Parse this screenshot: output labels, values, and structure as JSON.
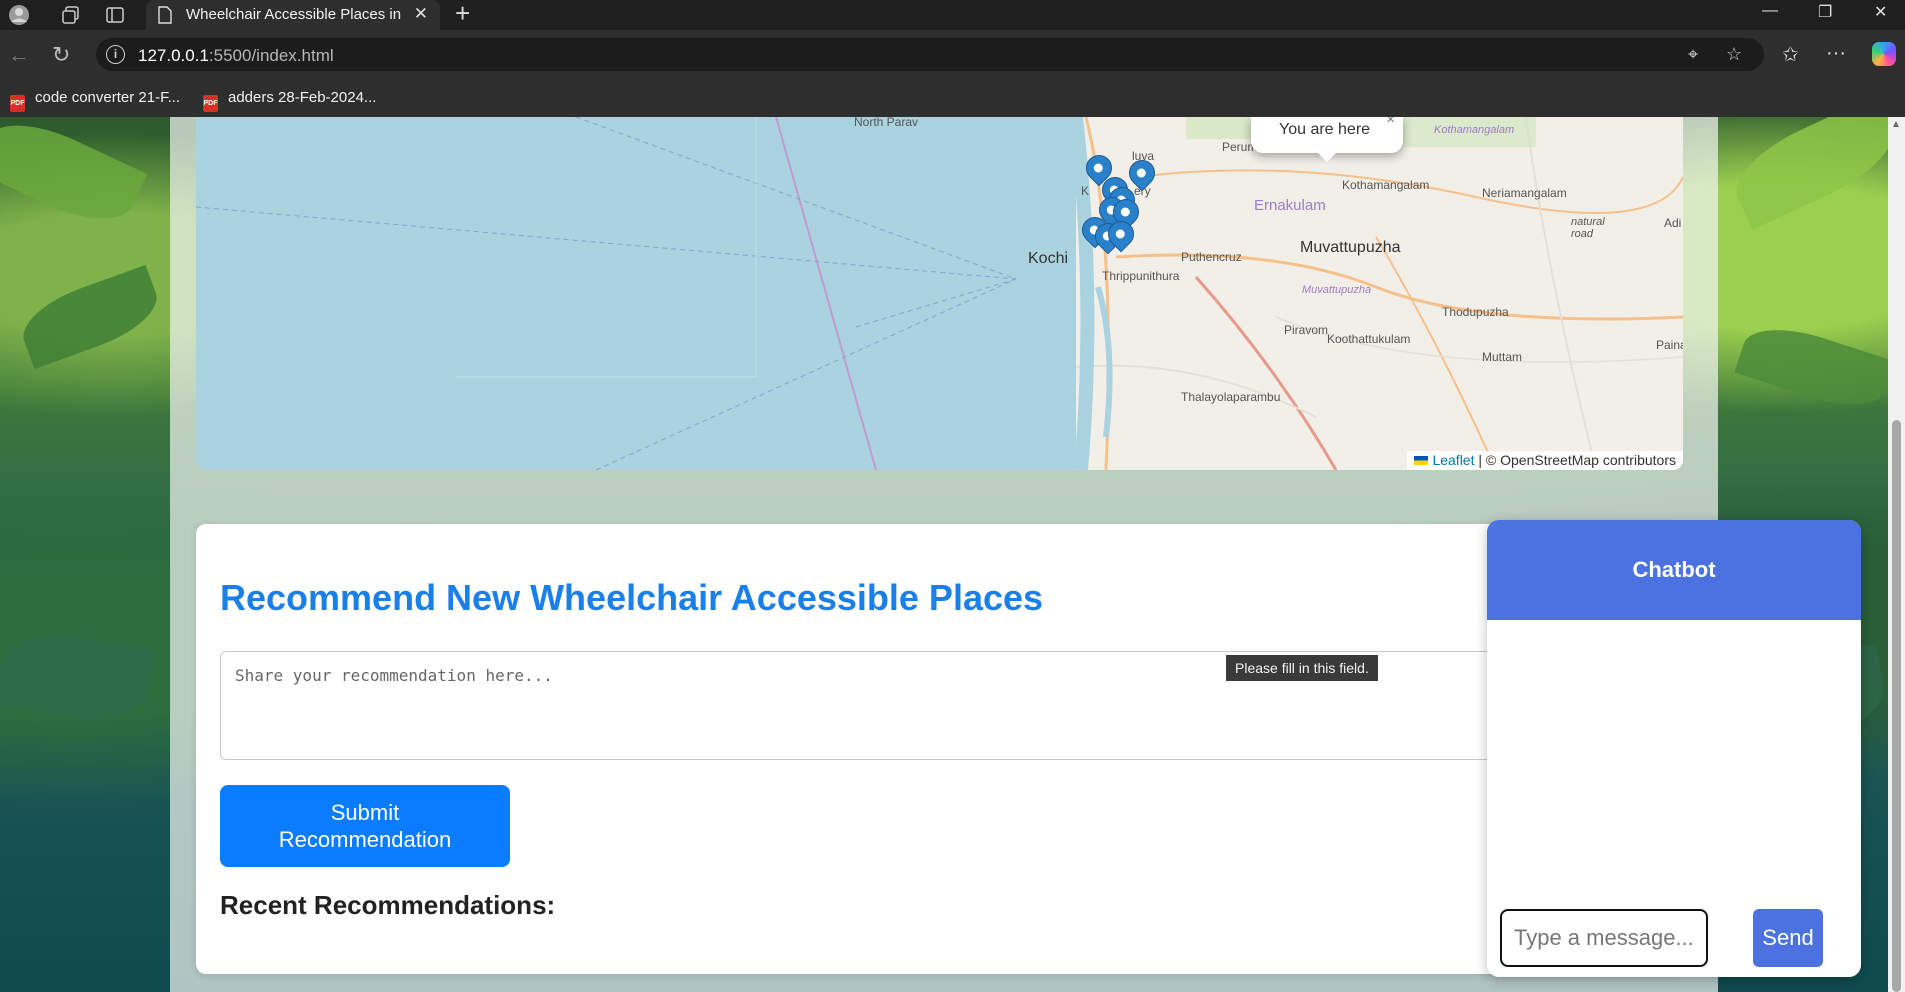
{
  "browser": {
    "tab_title": "Wheelchair Accessible Places in K",
    "address_host": "127.0.0.1",
    "address_path": ":5500/index.html",
    "bookmarks": [
      {
        "label": "code converter 21-F..."
      },
      {
        "label": "adders 28-Feb-2024..."
      }
    ]
  },
  "map": {
    "labels": {
      "north_paravur": "North Parav",
      "aluva": "luva",
      "perumbavoor": "Perumbavoor",
      "kothamangalam_it": "Kothamangalam",
      "kothamangalam": "Kothamangalam",
      "neriamangalam": "Neriamangalam",
      "ernakulam": "Ernakulam",
      "kochi": "Kochi",
      "thrippunithura": "Thrippunithura",
      "puthencruz": "Puthencruz",
      "muvattupuzha": "Muvattupuzha",
      "muvattupuzha_it": "Muvattupuzha",
      "natural_road": "natural road",
      "adi": "Adi",
      "thodupuzha": "Thodupuzha",
      "piravom": "Piravom",
      "koothattukulam": "Koothattukulam",
      "paina": "Paina",
      "muttam": "Muttam",
      "thalayolaparambu": "Thalayolaparambu",
      "ery": "ery",
      "k": "K"
    },
    "popup_text": "You are here",
    "attribution": {
      "leaflet": "Leaflet",
      "rest": "| © OpenStreetMap contributors"
    }
  },
  "recommend": {
    "title": "Recommend New Wheelchair Accessible Places",
    "placeholder": "Share your recommendation here...",
    "tooltip": "Please fill in this field.",
    "submit_label": "Submit Recommendation",
    "recent_title": "Recent Recommendations:"
  },
  "chatbot": {
    "title": "Chatbot",
    "input_placeholder": "Type a message...",
    "send_label": "Send"
  },
  "colors": {
    "accent_blue": "#0a7cff",
    "chat_blue": "#4c72df",
    "title_blue": "#1a7fe8"
  }
}
